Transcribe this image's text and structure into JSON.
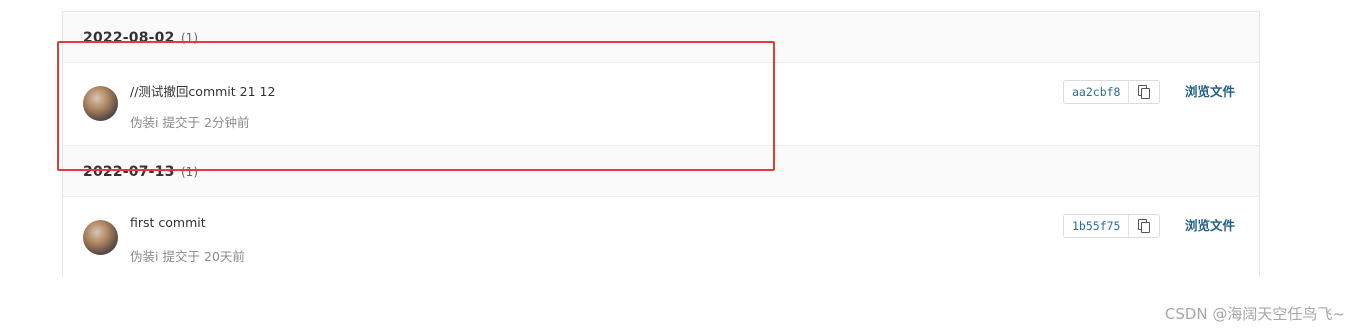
{
  "groups": [
    {
      "date": "2022-08-02",
      "count": "(1)",
      "commit": {
        "title": "//测试撤回commit 21 12",
        "author": "伪装i",
        "action": "提交于",
        "time": "2分钟前",
        "sha": "aa2cbf8",
        "browse_label": "浏览文件"
      }
    },
    {
      "date": "2022-07-13",
      "count": "(1)",
      "commit": {
        "title": "first commit",
        "author": "伪装i",
        "action": "提交于",
        "time": "20天前",
        "sha": "1b55f75",
        "browse_label": "浏览文件"
      }
    }
  ],
  "icons": {
    "copy": "copy-icon"
  },
  "colors": {
    "highlight": "#e33b35",
    "link": "#1f5f86",
    "sha": "#2a6d98"
  },
  "watermark": "CSDN @海阔天空任鸟飞~"
}
